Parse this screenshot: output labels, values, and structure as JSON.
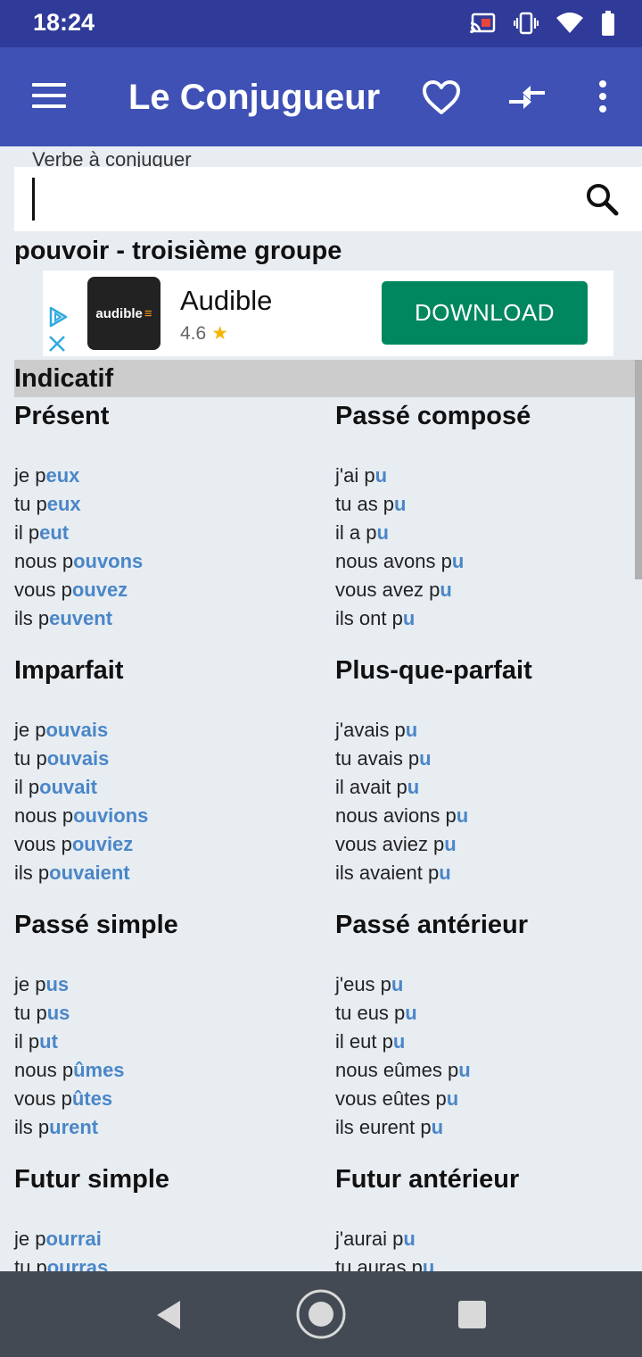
{
  "status_bar": {
    "time": "18:24"
  },
  "app_bar": {
    "title": "Le Conjugueur"
  },
  "search": {
    "label": "Verbe à conjuguer",
    "value": "",
    "placeholder": ""
  },
  "verb_title": "pouvoir - troisième groupe",
  "ad": {
    "name": "Audible",
    "logo_text": "audible",
    "rating": "4.6",
    "cta": "DOWNLOAD"
  },
  "mood": "Indicatif",
  "tenses": [
    {
      "name": "Présent",
      "lines": [
        [
          "je p",
          "eux"
        ],
        [
          "tu p",
          "eux"
        ],
        [
          "il p",
          "eut"
        ],
        [
          "nous p",
          "ouvons"
        ],
        [
          "vous p",
          "ouvez"
        ],
        [
          "ils p",
          "euvent"
        ]
      ]
    },
    {
      "name": "Passé composé",
      "lines": [
        [
          "j'ai p",
          "u"
        ],
        [
          "tu as p",
          "u"
        ],
        [
          "il a p",
          "u"
        ],
        [
          "nous avons p",
          "u"
        ],
        [
          "vous avez p",
          "u"
        ],
        [
          "ils ont p",
          "u"
        ]
      ]
    },
    {
      "name": "Imparfait",
      "lines": [
        [
          "je p",
          "ouvais"
        ],
        [
          "tu p",
          "ouvais"
        ],
        [
          "il p",
          "ouvait"
        ],
        [
          "nous p",
          "ouvions"
        ],
        [
          "vous p",
          "ouviez"
        ],
        [
          "ils p",
          "ouvaient"
        ]
      ]
    },
    {
      "name": "Plus-que-parfait",
      "lines": [
        [
          "j'avais p",
          "u"
        ],
        [
          "tu avais p",
          "u"
        ],
        [
          "il avait p",
          "u"
        ],
        [
          "nous avions p",
          "u"
        ],
        [
          "vous aviez p",
          "u"
        ],
        [
          "ils avaient p",
          "u"
        ]
      ]
    },
    {
      "name": "Passé simple",
      "lines": [
        [
          "je p",
          "us"
        ],
        [
          "tu p",
          "us"
        ],
        [
          "il p",
          "ut"
        ],
        [
          "nous p",
          "ûmes"
        ],
        [
          "vous p",
          "ûtes"
        ],
        [
          "ils p",
          "urent"
        ]
      ]
    },
    {
      "name": "Passé antérieur",
      "lines": [
        [
          "j'eus p",
          "u"
        ],
        [
          "tu eus p",
          "u"
        ],
        [
          "il eut p",
          "u"
        ],
        [
          "nous eûmes p",
          "u"
        ],
        [
          "vous eûtes p",
          "u"
        ],
        [
          "ils eurent p",
          "u"
        ]
      ]
    },
    {
      "name": "Futur simple",
      "lines": [
        [
          "je p",
          "ourrai"
        ],
        [
          "tu p",
          "ourras"
        ]
      ]
    },
    {
      "name": "Futur antérieur",
      "lines": [
        [
          "j'aurai p",
          "u"
        ],
        [
          "tu auras p",
          "u"
        ]
      ]
    }
  ],
  "colors": {
    "app_bar": "#3f51b5",
    "status_bar": "#2f3a99",
    "ending": "#4a86c8",
    "ad_button": "#01875f"
  }
}
